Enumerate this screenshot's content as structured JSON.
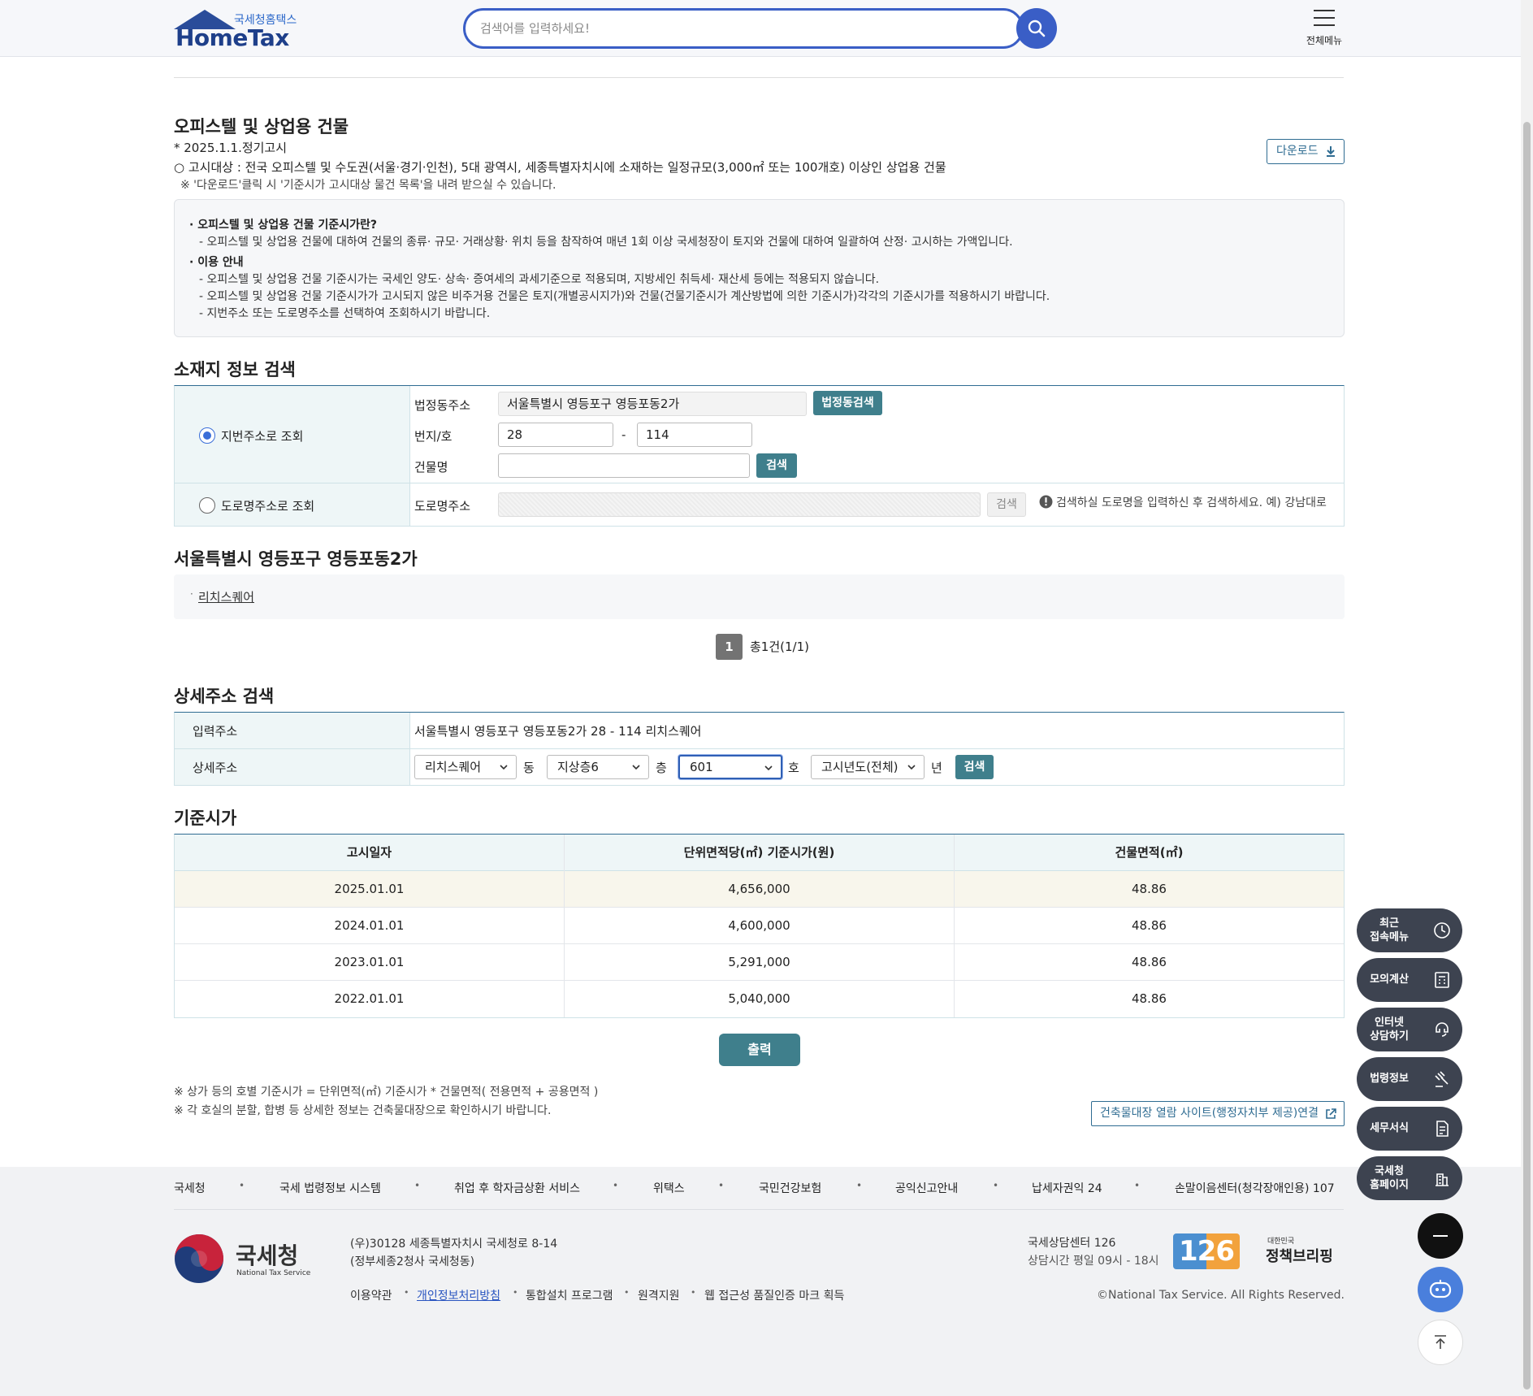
{
  "header": {
    "logo_sub": "국세청홈택스",
    "logo_main": "HomeTax",
    "search_placeholder": "검색어를 입력하세요!",
    "all_menu": "전체메뉴"
  },
  "section": {
    "title": "오피스텔 및 상업용 건물",
    "notice_date": "* 2025.1.1.정기고시",
    "target": "○ 고시대상 : 전국 오피스텔 및 수도권(서울·경기·인천), 5대 광역시, 세종특별자치시에 소재하는 일정규모(3,000㎡ 또는 100개호) 이상인 상업용 건물",
    "download_note": "※ '다운로드'클릭 시 '기준시가 고시대상 물건 목록'을 내려 받으실 수 있습니다.",
    "download_label": "다운로드"
  },
  "info": {
    "head1": "· 오피스텔 및 상업용 건물 기준시가란?",
    "line1": "- 오피스텔 및 상업용 건물에 대하여 건물의 종류· 규모· 거래상황· 위치 등을 참작하여 매년 1회 이상 국세청장이 토지와 건물에 대하여 일괄하여 산정· 고시하는 가액입니다.",
    "head2": "· 이용 안내",
    "line2": "- 오피스텔 및 상업용 건물 기준시가는 국세인 양도· 상속· 증여세의 과세기준으로 적용되며, 지방세인 취득세· 재산세 등에는 적용되지 않습니다.",
    "line3": "- 오피스텔 및 상업용 건물 기준시가가 고시되지 않은 비주거용 건물은 토지(개별공시지가)와 건물(건물기준시가 계산방법에 의한 기준시가)각각의 기준시가를 적용하시기 바랍니다.",
    "line4": "- 지번주소 또는 도로명주소를 선택하여 조회하시기 바랍니다."
  },
  "location_search": {
    "title": "소재지 정보 검색",
    "radio_jibun": "지번주소로 조회",
    "radio_road": "도로명주소로 조회",
    "label_legal": "법정동주소",
    "legal_value": "서울특별시 영등포구 영등포동2가",
    "legal_search_btn": "법정동검색",
    "label_lot": "번지/호",
    "lot_main": "28",
    "lot_dash": "-",
    "lot_sub": "114",
    "label_building": "건물명",
    "building_value": "",
    "search_btn": "검색",
    "label_road": "도로명주소",
    "road_value": "",
    "road_search_btn": "검색",
    "road_hint": "검색하실 도로명을 입력하신 후 검색하세요. 예) 강남대로"
  },
  "results": {
    "title": "서울특별시 영등포구 영등포동2가",
    "items": [
      "리치스퀘어"
    ],
    "page": "1",
    "total": "총1건(1/1)"
  },
  "detail_search": {
    "title": "상세주소 검색",
    "label_input": "입력주소",
    "input_value": "서울특별시 영등포구 영등포동2가 28 - 114 리치스퀘어",
    "label_detail": "상세주소",
    "dong_value": "리치스퀘어",
    "dong_unit": "동",
    "floor_value": "지상층6",
    "floor_unit": "층",
    "ho_value": "601",
    "ho_unit": "호",
    "year_value": "고시년도(전체)",
    "year_unit": "년",
    "search_btn": "검색"
  },
  "price": {
    "title": "기준시가",
    "headers": [
      "고시일자",
      "단위면적당(㎡) 기준시가(원)",
      "건물면적(㎡)"
    ],
    "rows": [
      [
        "2025.01.01",
        "4,656,000",
        "48.86"
      ],
      [
        "2024.01.01",
        "4,600,000",
        "48.86"
      ],
      [
        "2023.01.01",
        "5,291,000",
        "48.86"
      ],
      [
        "2022.01.01",
        "5,040,000",
        "48.86"
      ]
    ],
    "print_btn": "출력",
    "note1": "※ 상가 등의 호별 기준시가 = 단위면적(㎡) 기준시가 * 건물면적( 전용면적 + 공용면적 )",
    "note2": "※ 각 호실의 분할, 합병 등 상세한 정보는 건축물대장으로 확인하시기 바랍니다.",
    "ext_link": "건축물대장 열람 사이트(행정자치부 제공)연결"
  },
  "quick_menu": [
    {
      "label": "최근\n접속메뉴",
      "icon": "clock-icon"
    },
    {
      "label": "모의계산",
      "icon": "calculator-icon"
    },
    {
      "label": "인터넷\n상담하기",
      "icon": "chat-icon"
    },
    {
      "label": "법령정보",
      "icon": "gavel-icon"
    },
    {
      "label": "세무서식",
      "icon": "document-icon"
    },
    {
      "label": "국세청\n홈페이지",
      "icon": "building-icon"
    }
  ],
  "footer": {
    "links": [
      "국세청",
      "국세 법령정보 시스템",
      "취업 후 학자금상환 서비스",
      "위택스",
      "국민건강보험",
      "공익신고안내",
      "납세자권익 24",
      "손말이음센터(청각장애인용) 107"
    ],
    "nts_kor": "국세청",
    "nts_eng": "National Tax Service",
    "addr1": "(우)30128 세종특별자치시 국세청로 8-14",
    "addr2": "(정부세종2청사 국세청동)",
    "bottom_links": [
      "이용약관",
      "개인정보처리방침",
      "통합설치 프로그램",
      "원격지원",
      "웹 접근성 품질인증 마크 획득"
    ],
    "call_center": "국세상담센터 126",
    "hours": "상담시간 평일 09시 - 18시",
    "badge": "126",
    "briefing_small": "대한민국",
    "briefing": "정책브리핑",
    "copyright": "©National Tax Service. All Rights Reserved."
  },
  "colors": {
    "brand_blue": "#3a5ec6",
    "teal": "#3f7f8c",
    "quick_menu_bg": "#3d4350",
    "chatbot_blue": "#4a7fdc"
  }
}
